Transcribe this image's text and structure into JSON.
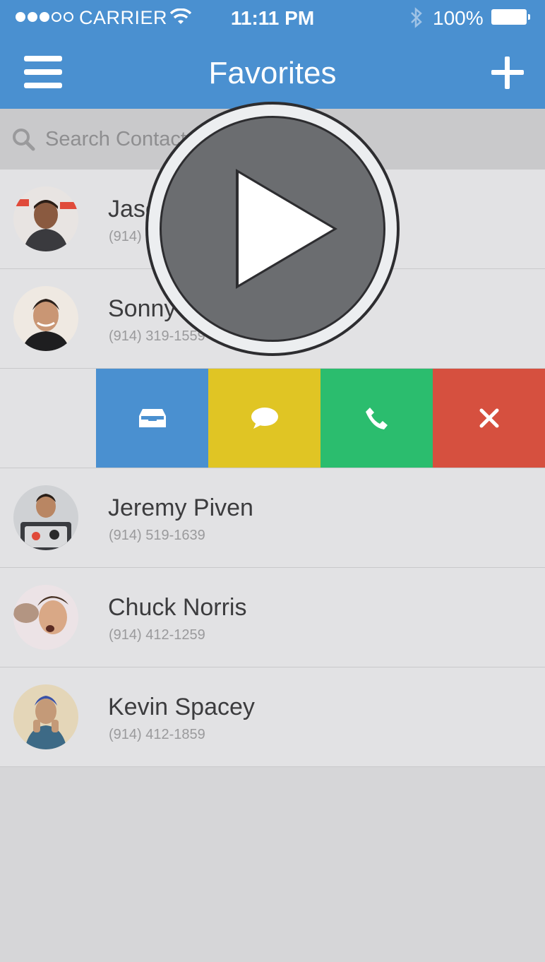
{
  "status_bar": {
    "carrier": "CARRIER",
    "time": "11:11 PM",
    "battery": "100%"
  },
  "nav": {
    "title": "Favorites"
  },
  "search": {
    "placeholder": "Search Contacts"
  },
  "contacts": [
    {
      "name": "Jason Novak",
      "phone": "(914) 519-1439"
    },
    {
      "name": "Sonny Byrd",
      "phone": "(914) 319-1559"
    },
    {
      "name": "Jeremy Piven",
      "phone": "(914) 519-1639"
    },
    {
      "name": "Chuck Norris",
      "phone": "(914) 412-1259"
    },
    {
      "name": "Kevin Spacey",
      "phone": "(914) 412-1859"
    }
  ],
  "actions": [
    {
      "icon": "archive-icon",
      "color": "#4a90d0"
    },
    {
      "icon": "message-icon",
      "color": "#e0c524"
    },
    {
      "icon": "phone-icon",
      "color": "#2bbd6e"
    },
    {
      "icon": "close-icon",
      "color": "#d6503f"
    }
  ],
  "colors": {
    "nav": "#4a90d0",
    "list_bg": "#e2e2e4",
    "empty_bg": "#d6d6d8"
  }
}
